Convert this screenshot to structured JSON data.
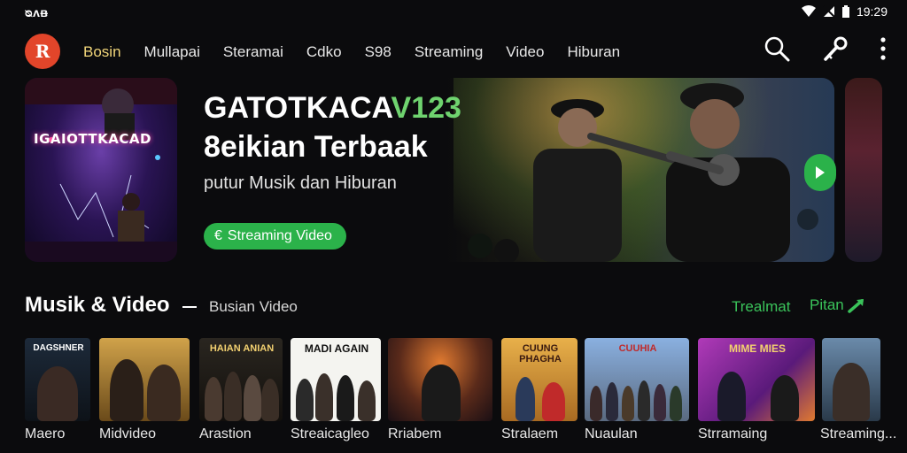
{
  "status_bar": {
    "left_text": "ᴓᴧᴃ",
    "time": "19:29"
  },
  "nav": {
    "logo_letter": "R",
    "tabs": [
      {
        "label": "Bosin",
        "active": true
      },
      {
        "label": "Mullapai",
        "active": false
      },
      {
        "label": "Steramai",
        "active": false
      },
      {
        "label": "Cdko",
        "active": false
      },
      {
        "label": "S98",
        "active": false
      },
      {
        "label": "Streaming",
        "active": false
      },
      {
        "label": "Video",
        "active": false
      },
      {
        "label": "Hiburan",
        "active": false
      }
    ]
  },
  "hero": {
    "poster_title": "IGAIOTTKACAD",
    "title_line1_main": "GATOTKACA",
    "title_line1_accent": "V123",
    "title_line2": "8eikian Terbaak",
    "subtitle": "putur Musik dan Hiburan",
    "button_label": "Streaming Video",
    "button_icon": "€"
  },
  "section": {
    "title": "Musik & Video",
    "subtitle": "Busian Video",
    "link1": "Trealmat",
    "link2": "Pitan"
  },
  "thumbnails": [
    {
      "label": "Maero",
      "caption": "DAGSHNER",
      "color": "#1d2a3a"
    },
    {
      "label": "Midvideo",
      "caption": "",
      "color": "#b08a3a"
    },
    {
      "label": "Arastion",
      "caption": "HAIAN ANIAN",
      "color": "#2a2620"
    },
    {
      "label": "Streaicagleo",
      "caption": "MADI AGAIN",
      "color": "#f4f4f0"
    },
    {
      "label": "Rriabem",
      "caption": "",
      "color": "#5a2a1a"
    },
    {
      "label": "Stralaem",
      "caption": "CUUNG PHAGHA",
      "color": "#c98a2a"
    },
    {
      "label": "Nuaulan",
      "caption": "CUUHIA",
      "color": "#6a8ab8"
    },
    {
      "label": "Strramaing",
      "caption": "MIME MIES",
      "color": "#8a3aa8"
    },
    {
      "label": "Streaming...",
      "caption": "",
      "color": "#4a6a8a"
    }
  ]
}
